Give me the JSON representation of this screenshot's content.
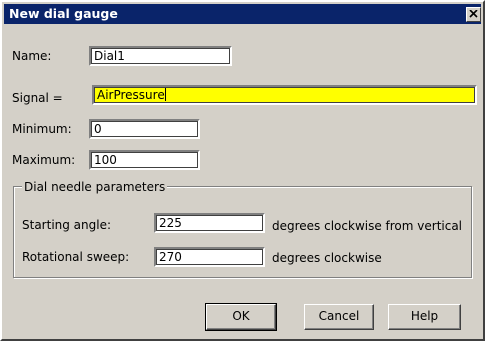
{
  "dialog": {
    "title": "New dial gauge",
    "close_icon": "close-icon"
  },
  "fields": {
    "name": {
      "label": "Name:",
      "value": "Dial1"
    },
    "signal": {
      "label": "Signal =",
      "value": "AirPressure"
    },
    "minimum": {
      "label": "Minimum:",
      "value": "0"
    },
    "maximum": {
      "label": "Maximum:",
      "value": "100"
    }
  },
  "needle": {
    "group_label": "Dial needle parameters",
    "starting_angle": {
      "label": "Starting angle:",
      "value": "225",
      "unit": "degrees clockwise from vertical"
    },
    "rotational_sweep": {
      "label": "Rotational sweep:",
      "value": "270",
      "unit": "degrees clockwise"
    }
  },
  "buttons": {
    "ok": "OK",
    "cancel": "Cancel",
    "help": "Help"
  },
  "colors": {
    "titlebar": "#0a246a",
    "dialog_face": "#d4d0c8",
    "signal_highlight": "#ffff00"
  }
}
